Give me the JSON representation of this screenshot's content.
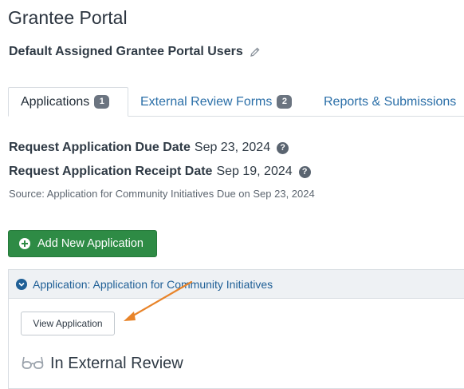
{
  "page": {
    "title": "Grantee Portal",
    "assigned_users_label": "Default Assigned Grantee Portal Users"
  },
  "tabs": [
    {
      "label": "Applications",
      "count": "1",
      "active": true
    },
    {
      "label": "External Review Forms",
      "count": "2",
      "active": false
    },
    {
      "label": "Reports & Submissions",
      "active": false
    }
  ],
  "dates": {
    "due_label": "Request Application Due Date",
    "due_value": "Sep 23, 2024",
    "receipt_label": "Request Application Receipt Date",
    "receipt_value": "Sep 19, 2024",
    "source": "Source: Application for Community Initiatives Due on Sep 23, 2024"
  },
  "actions": {
    "add_application_label": "Add New Application"
  },
  "application_panel": {
    "header": "Application: Application for Community Initiatives",
    "view_button": "View Application",
    "status": "In External Review"
  },
  "colors": {
    "primary_green": "#2e8b45",
    "link_blue": "#2b6fa8",
    "annotation_arrow": "#e8842a"
  },
  "icons": [
    "pencil-icon",
    "help-icon",
    "plus-circle-icon",
    "chevron-down-icon",
    "glasses-icon"
  ]
}
